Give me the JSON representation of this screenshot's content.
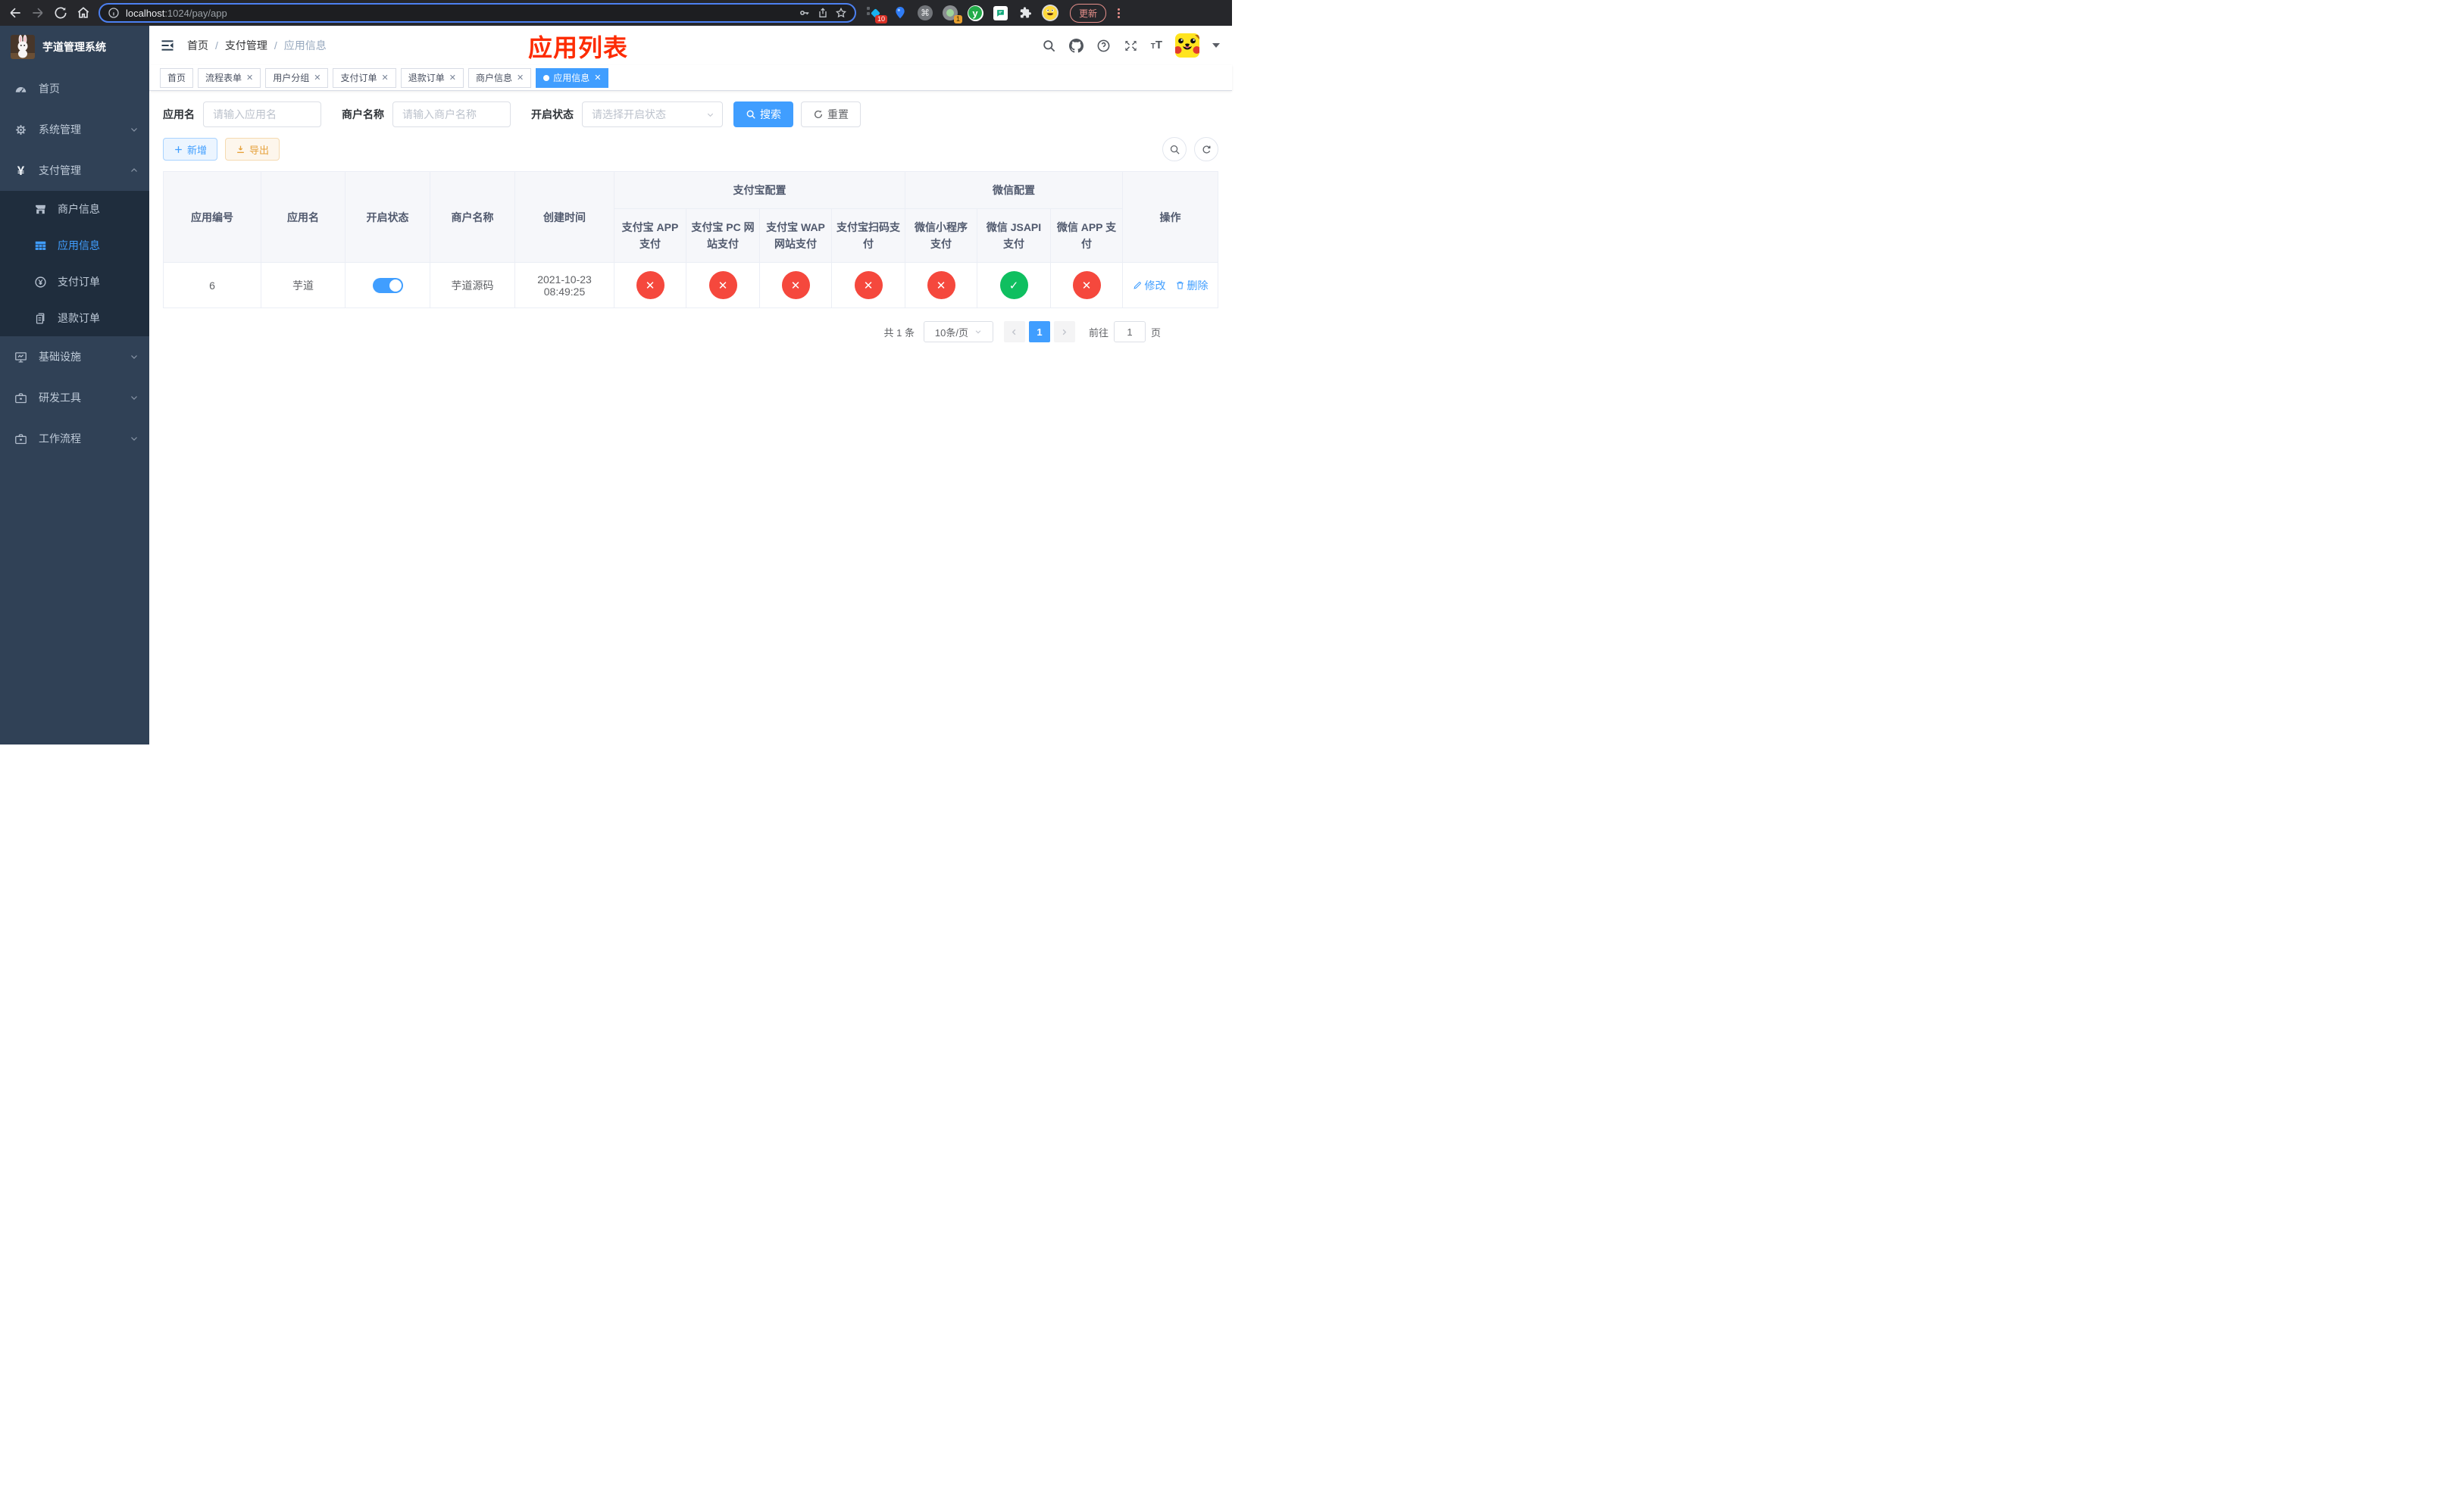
{
  "browser": {
    "url_host": "localhost",
    "url_rest": ":1024/pay/app",
    "update_label": "更新",
    "ext_badge_pin": "10",
    "ext_badge_rec": "1",
    "ext_y_letter": "y"
  },
  "sidebar": {
    "logo_title": "芋道管理系统",
    "items": [
      {
        "label": "首页"
      },
      {
        "label": "系统管理"
      },
      {
        "label": "支付管理",
        "children": [
          {
            "label": "商户信息"
          },
          {
            "label": "应用信息"
          },
          {
            "label": "支付订单"
          },
          {
            "label": "退款订单"
          }
        ]
      },
      {
        "label": "基础设施"
      },
      {
        "label": "研发工具"
      },
      {
        "label": "工作流程"
      }
    ]
  },
  "header": {
    "breadcrumb": [
      "首页",
      "支付管理",
      "应用信息"
    ],
    "overlay_title": "应用列表"
  },
  "tabs": [
    {
      "label": "首页"
    },
    {
      "label": "流程表单"
    },
    {
      "label": "用户分组"
    },
    {
      "label": "支付订单"
    },
    {
      "label": "退款订单"
    },
    {
      "label": "商户信息"
    },
    {
      "label": "应用信息"
    }
  ],
  "filters": {
    "name_label": "应用名",
    "name_placeholder": "请输入应用名",
    "merchant_label": "商户名称",
    "merchant_placeholder": "请输入商户名称",
    "status_label": "开启状态",
    "status_placeholder": "请选择开启状态",
    "search_label": "搜索",
    "reset_label": "重置"
  },
  "toolbar": {
    "add_label": "新增",
    "export_label": "导出"
  },
  "table": {
    "groups": {
      "alipay": "支付宝配置",
      "wechat": "微信配置"
    },
    "columns": [
      "应用编号",
      "应用名",
      "开启状态",
      "商户名称",
      "创建时间",
      "支付宝 APP 支付",
      "支付宝 PC 网站支付",
      "支付宝 WAP 网站支付",
      "支付宝扫码支付",
      "微信小程序支付",
      "微信 JSAPI 支付",
      "微信 APP 支付",
      "操作"
    ],
    "row": {
      "id": "6",
      "name": "芋道",
      "enabled": true,
      "merchant": "芋道源码",
      "created": "2021-10-23 08:49:25",
      "statuses": [
        false,
        false,
        false,
        false,
        false,
        true,
        false
      ],
      "edit_label": "修改",
      "delete_label": "删除"
    }
  },
  "pagination": {
    "total": "共 1 条",
    "per_page": "10条/页",
    "page": "1",
    "goto_label": "前往",
    "goto_value": "1",
    "unit_label": "页"
  },
  "colors": {
    "accent": "#409eff",
    "danger": "#f5483d",
    "success": "#0fbf60"
  }
}
